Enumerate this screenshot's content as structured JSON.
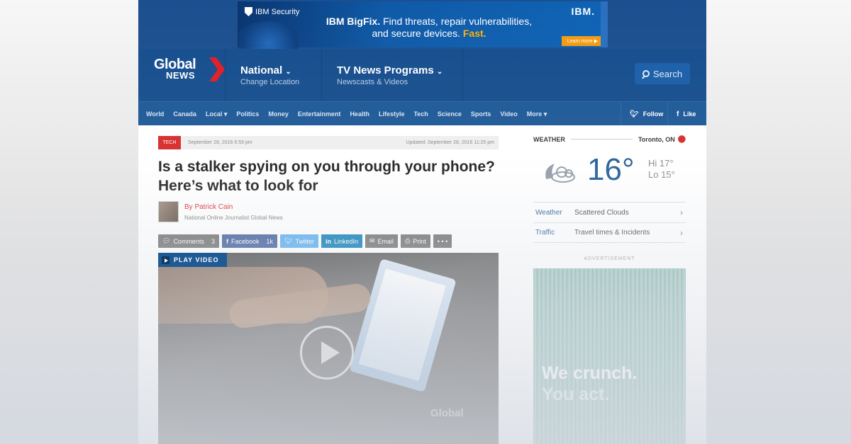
{
  "top_ad": {
    "brand": "IBM Security",
    "headline_bold": "IBM BigFix.",
    "headline_rest": "Find threats, repair vulnerabilities,",
    "headline_line2": "and secure devices.",
    "headline_fast": "Fast.",
    "logo": "IBM.",
    "cta": "Learn more ▶"
  },
  "header": {
    "logo_top": "Global",
    "logo_bottom": "NEWS",
    "nav": [
      {
        "title": "National",
        "subtitle": "Change Location"
      },
      {
        "title": "TV News Programs",
        "subtitle": "Newscasts & Videos"
      }
    ],
    "search_label": "Search"
  },
  "section_nav": {
    "items": [
      "World",
      "Canada",
      "Local ▾",
      "Politics",
      "Money",
      "Entertainment",
      "Health",
      "Lifestyle",
      "Tech",
      "Science",
      "Sports",
      "Video",
      "More ▾"
    ],
    "follow_label": "Follow",
    "like_label": "Like"
  },
  "article": {
    "tag": "TECH",
    "published": "September 28, 2016 6:59 pm",
    "updated": "Updated: September 28, 2016 11:25 pm",
    "title": "Is a stalker spying on you through your phone? Here’s what to look for",
    "author_name": "By Patrick Cain",
    "author_role": "National Online Journalist  Global News",
    "share": {
      "comments_label": "Comments",
      "comments_count": "3",
      "facebook_label": "Facebook",
      "facebook_count": "1k",
      "twitter_label": "Twitter",
      "linkedin_label": "LinkedIn",
      "email_label": "Email",
      "print_label": "Print",
      "more_label": "• • •"
    },
    "video_badge": "PLAY VIDEO",
    "video_watermark": "Global"
  },
  "weather": {
    "label": "WEATHER",
    "location": "Toronto, ON",
    "temp": "16°",
    "hi": "Hi 17°",
    "lo": "Lo 15°",
    "rows": [
      {
        "key": "Weather",
        "value": "Scattered Clouds"
      },
      {
        "key": "Traffic",
        "value": "Travel times & Incidents"
      }
    ]
  },
  "sidebar_ad": {
    "label": "ADVERTISEMENT",
    "line1": "We crunch.",
    "line2": "You act."
  }
}
